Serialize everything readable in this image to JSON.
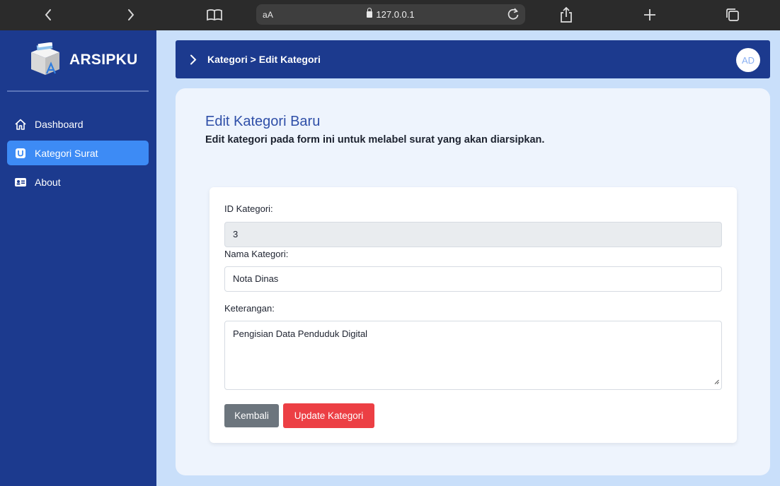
{
  "browser": {
    "text_size_label": "aA",
    "url": "127.0.0.1"
  },
  "sidebar": {
    "brand": "ARSIPKU",
    "items": [
      {
        "label": "Dashboard",
        "icon": "home-icon",
        "active": false
      },
      {
        "label": "Kategori Surat",
        "icon": "folder-icon",
        "active": true
      },
      {
        "label": "About",
        "icon": "id-card-icon",
        "active": false
      }
    ]
  },
  "header": {
    "breadcrumb": "Kategori > Edit Kategori",
    "avatar_initials": "AD"
  },
  "main": {
    "title": "Edit Kategori Baru",
    "subtitle": "Edit kategori pada form ini untuk melabel surat yang akan diarsipkan.",
    "form": {
      "id_label": "ID Kategori:",
      "id_value": "3",
      "name_label": "Nama Kategori:",
      "name_value": "Nota Dinas",
      "desc_label": "Keterangan:",
      "desc_value": "Pengisian Data Penduduk Digital",
      "back_button": "Kembali",
      "update_button": "Update Kategori"
    }
  },
  "colors": {
    "sidebar_bg": "#1c3a8e",
    "active_item": "#3d8bf5",
    "page_bg": "#c9dffa",
    "update_button": "#ec3f44",
    "back_button": "#6c757d"
  }
}
